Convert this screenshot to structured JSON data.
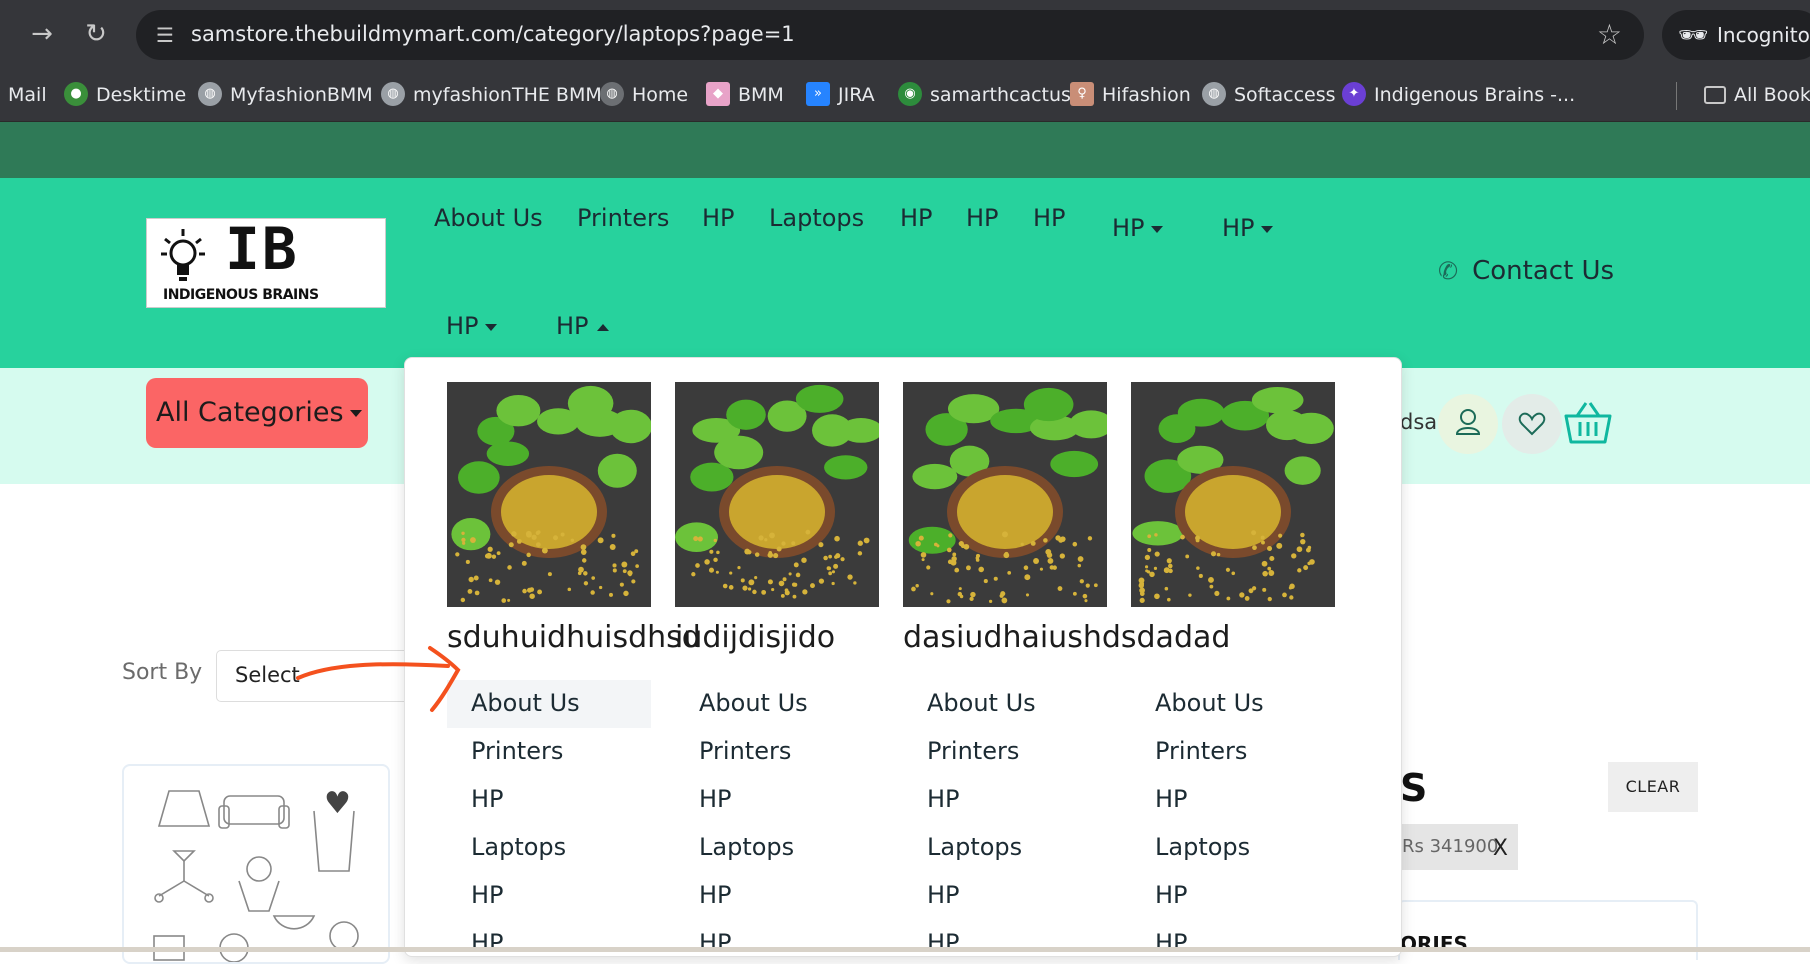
{
  "browser": {
    "url": "samstore.thebuildmymart.com/category/laptops?page=1",
    "incognito_label": "Incognito",
    "bookmarks": [
      {
        "label": "Mail",
        "icon": "mail-icon",
        "color": "#35363a"
      },
      {
        "label": "Desktime",
        "icon": "desktime-icon",
        "color": "#3a8f3a"
      },
      {
        "label": "MyfashionBMM",
        "icon": "globe-icon",
        "color": "#9aa0a6"
      },
      {
        "label": "myfashionTHE BMM",
        "icon": "globe-icon",
        "color": "#9aa0a6"
      },
      {
        "label": "Home",
        "icon": "globe-icon",
        "color": "#6c6f73"
      },
      {
        "label": "BMM",
        "icon": "bmm-icon",
        "color": "#e8a3c8"
      },
      {
        "label": "JIRA",
        "icon": "jira-icon",
        "color": "#2684ff"
      },
      {
        "label": "samarthcactus",
        "icon": "cactus-icon",
        "color": "#2d8c3c"
      },
      {
        "label": "Hifashion",
        "icon": "hifashion-icon",
        "color": "#c98e77"
      },
      {
        "label": "Softaccess",
        "icon": "globe-icon",
        "color": "#9aa0a6"
      },
      {
        "label": "Indigenous Brains -...",
        "icon": "ib-icon",
        "color": "#6b3fd4"
      }
    ],
    "all_bookmarks": "All Bookm"
  },
  "site": {
    "logo": {
      "initials": "IB",
      "name": "INDIGENOUS BRAINS"
    },
    "nav_row1": [
      "About Us",
      "Printers",
      "HP",
      "Laptops",
      "HP",
      "HP",
      "HP"
    ],
    "nav_dropdowns_row1": [
      "HP",
      "HP"
    ],
    "nav_row2": [
      "HP",
      "HP"
    ],
    "contact": "Contact Us",
    "all_categories": "All Categories",
    "search_tail": "dsa",
    "sort_label": "Sort By",
    "sort_value": "Select",
    "filter_heading_tail": "S",
    "clear_button": "CLEAR",
    "price_chip": "Rs 341900",
    "chip_close": "X",
    "categories_heading_tail": "ORIES"
  },
  "dropdown": {
    "columns": [
      {
        "title": "sduhuidhuisdhsd",
        "links": [
          "About Us",
          "Printers",
          "HP",
          "Laptops",
          "HP",
          "HP"
        ]
      },
      {
        "title": "iudijdisjido",
        "links": [
          "About Us",
          "Printers",
          "HP",
          "Laptops",
          "HP",
          "HP"
        ]
      },
      {
        "title": "dasiudhaiushdsdadad",
        "links": [
          "About Us",
          "Printers",
          "HP",
          "Laptops",
          "HP",
          "HP"
        ]
      },
      {
        "title": "",
        "links": [
          "About Us",
          "Printers",
          "HP",
          "Laptops",
          "HP",
          "HP"
        ]
      }
    ],
    "active_link": "About Us"
  },
  "colors": {
    "topbar": "#2f7a57",
    "header": "#27d29d",
    "subbar": "#d6fbef",
    "all_categories_btn": "#fb6565",
    "annotation_arrow": "#f4511e"
  }
}
